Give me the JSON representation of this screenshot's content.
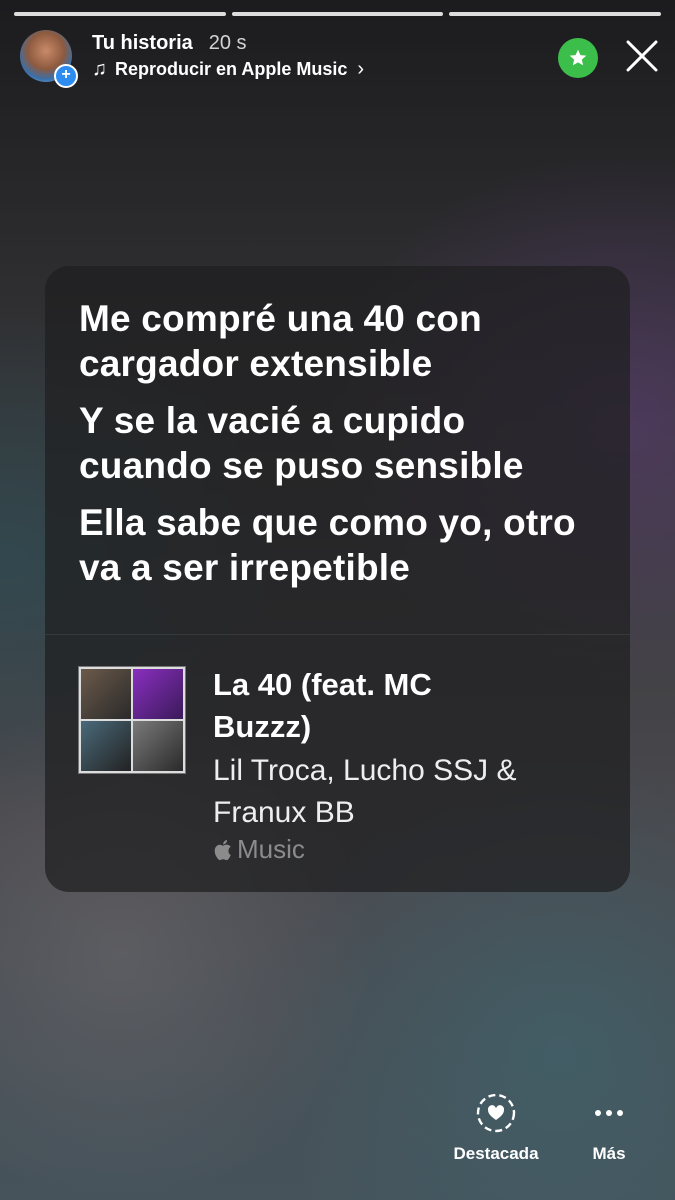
{
  "header": {
    "username": "Tu historia",
    "time": "20 s",
    "music_link": "Reproducir en Apple Music",
    "icons": {
      "avatar": "avatar",
      "add": "plus-icon",
      "music": "music-note-icon",
      "chevron": "chevron-right-icon",
      "close": "close-icon",
      "star": "star-icon"
    }
  },
  "progress_segments": 3,
  "lyrics": [
    "Me compré una 40 con cargador extensible",
    "Y se la vacié a cupido cuando se puso sensible",
    "Ella sabe que como yo, otro va a ser irrepetible"
  ],
  "song": {
    "title": "La 40 (feat. MC Buzzz)",
    "artist": "Lil Troca, Lucho SSJ & Franux BB",
    "service": "Music"
  },
  "actions": {
    "highlight": "Destacada",
    "more": "Más"
  },
  "colors": {
    "star_badge": "#3bbf4a",
    "add_badge": "#2d8cf0"
  }
}
